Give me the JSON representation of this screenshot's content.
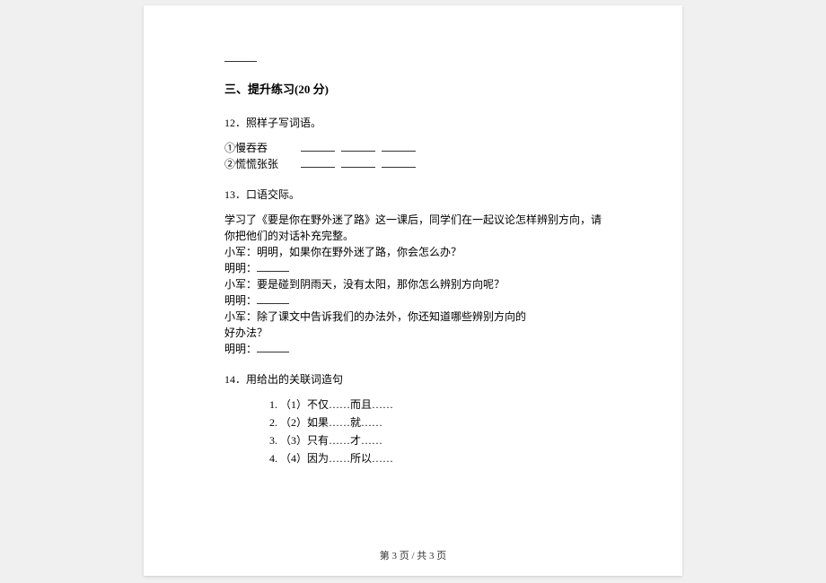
{
  "topLine": "______",
  "section": {
    "heading": "三、提升练习(20 分)"
  },
  "q12": {
    "header": "12．照样子写词语。",
    "line1_prefix": "①慢吞吞",
    "line2_prefix": "②慌慌张张"
  },
  "q13": {
    "header": "13．口语交际。",
    "para1": "学习了《要是你在野外迷了路》这一课后，同学们在一起议论怎样辨别方向，请你把他们的对话补充完整。",
    "line_xj1": "小军：明明，如果你在野外迷了路，你会怎么办？",
    "line_mm1_prefix": "明明：",
    "line_xj2": "小军：要是碰到阴雨天，没有太阳，那你怎么辨别方向呢？",
    "line_mm2_prefix": "明明：",
    "line_xj3a": "小军：除了课文中告诉我们的办法外，你还知道哪些辨别方向的",
    "line_xj3b": "好办法？",
    "line_mm3_prefix": "明明："
  },
  "q14": {
    "header": "14．用给出的关联词造句",
    "items": [
      {
        "num": "1.",
        "text": "（1）不仅……而且……"
      },
      {
        "num": "2.",
        "text": "（2）如果……就……"
      },
      {
        "num": "3.",
        "text": "（3）只有……才……"
      },
      {
        "num": "4.",
        "text": "（4）因为……所以……"
      }
    ]
  },
  "footer": "第 3 页  /  共 3 页"
}
